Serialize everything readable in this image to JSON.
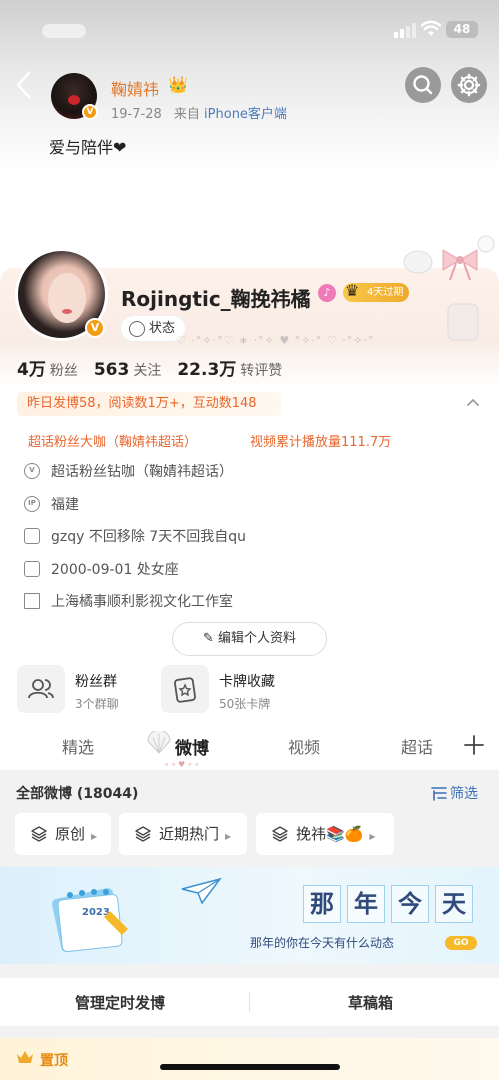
{
  "post_header": {
    "author": "鞠婧祎",
    "date": "19-7-28",
    "source_prefix": "来自",
    "source": "iPhone客户端",
    "text": "爱与陪伴❤"
  },
  "status_bar": {
    "battery": "48"
  },
  "profile": {
    "username": "Rojingtic_鞠挽祎橘",
    "vip_badge": "4天过期",
    "status_chip": "状态",
    "stats": [
      {
        "num": "4万",
        "label": "粉丝"
      },
      {
        "num": "563",
        "label": "关注"
      },
      {
        "num": "22.3万",
        "label": "转评赞"
      }
    ],
    "summary": "昨日发博58，阅读数1万+，互动数148",
    "achievements": [
      "超话粉丝大咖（鞠婧祎超话）",
      "视频累计播放量111.7万"
    ],
    "info": [
      {
        "icon": "v-badge-icon",
        "text": "超话粉丝钻咖（鞠婧祎超话）"
      },
      {
        "icon": "ip-icon",
        "text": "福建",
        "badge": "IP"
      },
      {
        "icon": "document-icon",
        "text": "gzqy 不回移除 7天不回我自qu"
      },
      {
        "icon": "calendar-icon",
        "text": "2000-09-01 处女座"
      },
      {
        "icon": "building-icon",
        "text": "上海橘事顺利影视文化工作室"
      }
    ],
    "edit_button": "编辑个人资料"
  },
  "cards": [
    {
      "title": "粉丝群",
      "sub": "3个群聊",
      "icon": "fans-group-icon"
    },
    {
      "title": "卡牌收藏",
      "sub": "50张卡牌",
      "icon": "card-collection-icon"
    }
  ],
  "tabs": [
    "精选",
    "微博",
    "视频",
    "超话"
  ],
  "active_tab": "微博",
  "feed": {
    "title": "全部微博 (18044)",
    "filter": "筛选",
    "chips": [
      "原创",
      "近期热门",
      "挽祎📚🍊"
    ]
  },
  "banner": {
    "calendar_year": "2023",
    "chars": [
      "那",
      "年",
      "今",
      "天"
    ],
    "sub": "那年的你在今天有什么动态",
    "go": "GO"
  },
  "actions": [
    "管理定时发博",
    "草稿箱"
  ],
  "pinned": "置顶",
  "colors": {
    "orange": "#e8662d",
    "link_blue": "#3b6fb6",
    "name_orange": "#e0782a",
    "vip_gold": "#f0a82b"
  }
}
